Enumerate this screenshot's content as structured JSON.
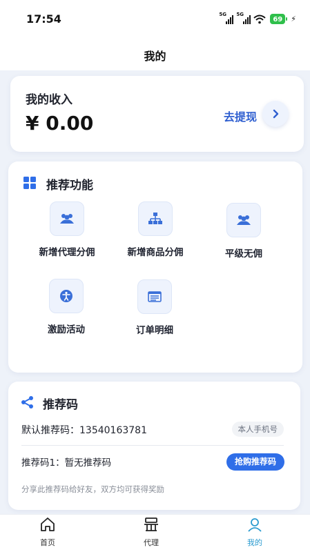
{
  "status": {
    "time": "17:54",
    "signal1": "5G",
    "signal2": "5G",
    "battery": "69"
  },
  "page": {
    "title": "我的"
  },
  "income": {
    "label": "我的收入",
    "amount": "¥ 0.00",
    "withdraw": "去提现"
  },
  "functions": {
    "title": "推荐功能",
    "items": [
      {
        "label": "新增代理分佣",
        "icon": "users-icon"
      },
      {
        "label": "新增商品分佣",
        "icon": "sitemap-icon"
      },
      {
        "label": "平级无佣",
        "icon": "users-icon"
      },
      {
        "label": "激励活动",
        "icon": "accessibility-icon"
      },
      {
        "label": "订单明细",
        "icon": "list-icon"
      }
    ]
  },
  "referral": {
    "title": "推荐码",
    "default_label": "默认推荐码：13540163781",
    "phone_tag": "本人手机号",
    "code1_label": "推荐码1：暂无推荐码",
    "buy_button": "抢购推荐码",
    "note": "分享此推荐码给好友，双方均可获得奖励"
  },
  "tabs": [
    {
      "label": "首页",
      "icon": "home-icon"
    },
    {
      "label": "代理",
      "icon": "agent-icon"
    },
    {
      "label": "我的",
      "icon": "profile-icon",
      "active": true
    }
  ],
  "colors": {
    "accent": "#2f6ee8",
    "active_tab": "#2a9bd0"
  }
}
